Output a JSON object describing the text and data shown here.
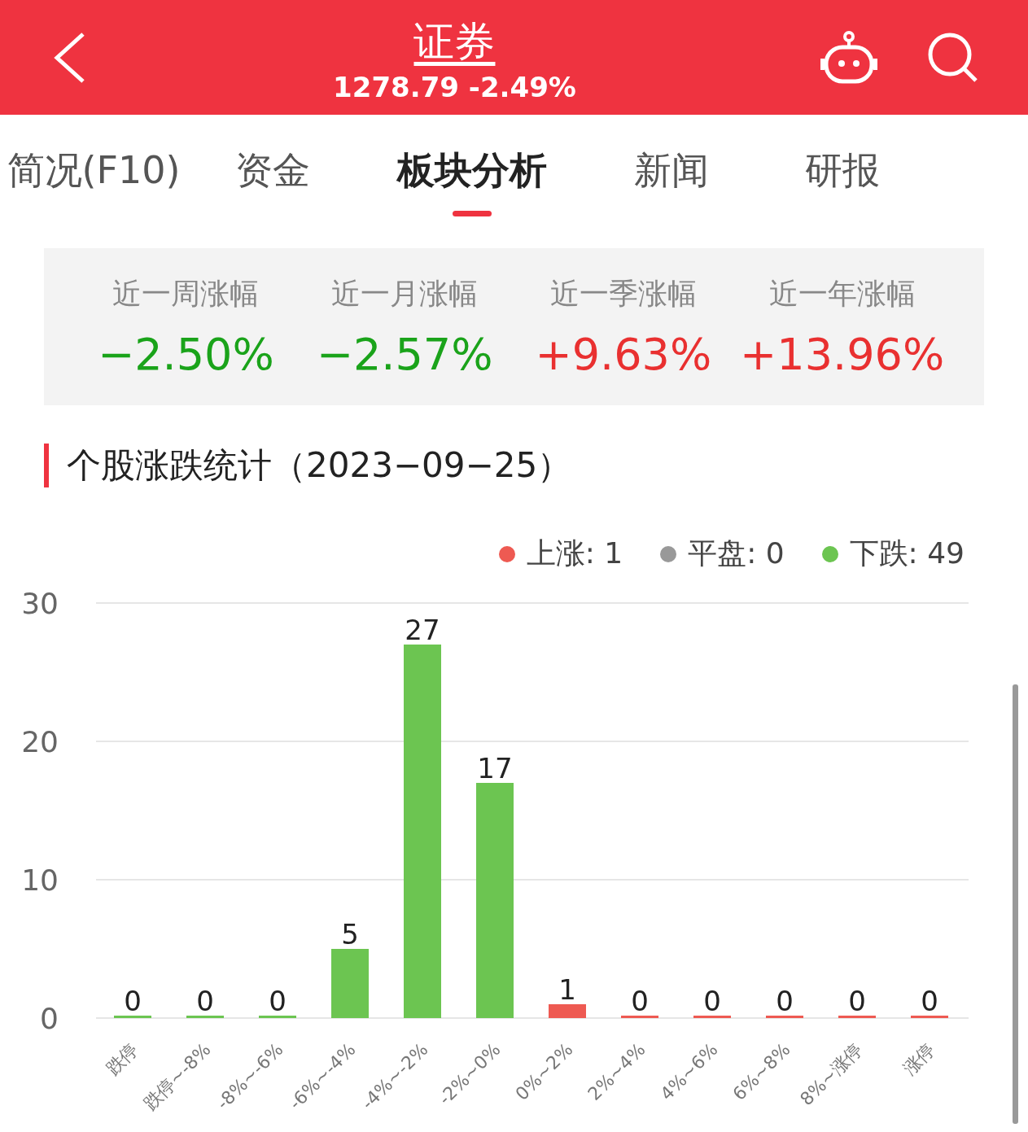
{
  "header": {
    "title": "证券",
    "quote": "1278.79 -2.49%"
  },
  "tabs": [
    {
      "label": "简况(F10)",
      "selected": false
    },
    {
      "label": "资金",
      "selected": false
    },
    {
      "label": "板块分析",
      "selected": true
    },
    {
      "label": "新闻",
      "selected": false
    },
    {
      "label": "研报",
      "selected": false
    }
  ],
  "stats": [
    {
      "label": "近一周涨幅",
      "value": "−2.50%",
      "color": "#1aa31a"
    },
    {
      "label": "近一月涨幅",
      "value": "−2.57%",
      "color": "#1aa31a"
    },
    {
      "label": "近一季涨幅",
      "value": "+9.63%",
      "color": "#e93030"
    },
    {
      "label": "近一年涨幅",
      "value": "+13.96%",
      "color": "#e93030"
    }
  ],
  "section": {
    "title": "个股涨跌统计（2023−09−25）",
    "legend": [
      {
        "label": "上涨: 1",
        "color": "#ee5a52"
      },
      {
        "label": "平盘: 0",
        "color": "#999999"
      },
      {
        "label": "下跌: 49",
        "color": "#6cc551"
      }
    ],
    "chart_data": {
      "type": "bar",
      "data_labels": true,
      "categories": [
        "跌停",
        "跌停~-8%",
        "-8%~-6%",
        "-6%~-4%",
        "-4%~-2%",
        "-2%~0%",
        "0%~2%",
        "2%~4%",
        "4%~6%",
        "6%~8%",
        "8%~涨停",
        "涨停"
      ],
      "yticks": [
        0,
        10,
        20,
        30
      ],
      "ylim": [
        0,
        30
      ],
      "series": [
        {
          "color": "#6cc551",
          "values": [
            0,
            0,
            0,
            5,
            27,
            17,
            null,
            null,
            null,
            null,
            null,
            null
          ]
        },
        {
          "color": "#ee5a52",
          "values": [
            null,
            null,
            null,
            null,
            null,
            null,
            1,
            0,
            0,
            0,
            0,
            0
          ]
        }
      ]
    }
  }
}
